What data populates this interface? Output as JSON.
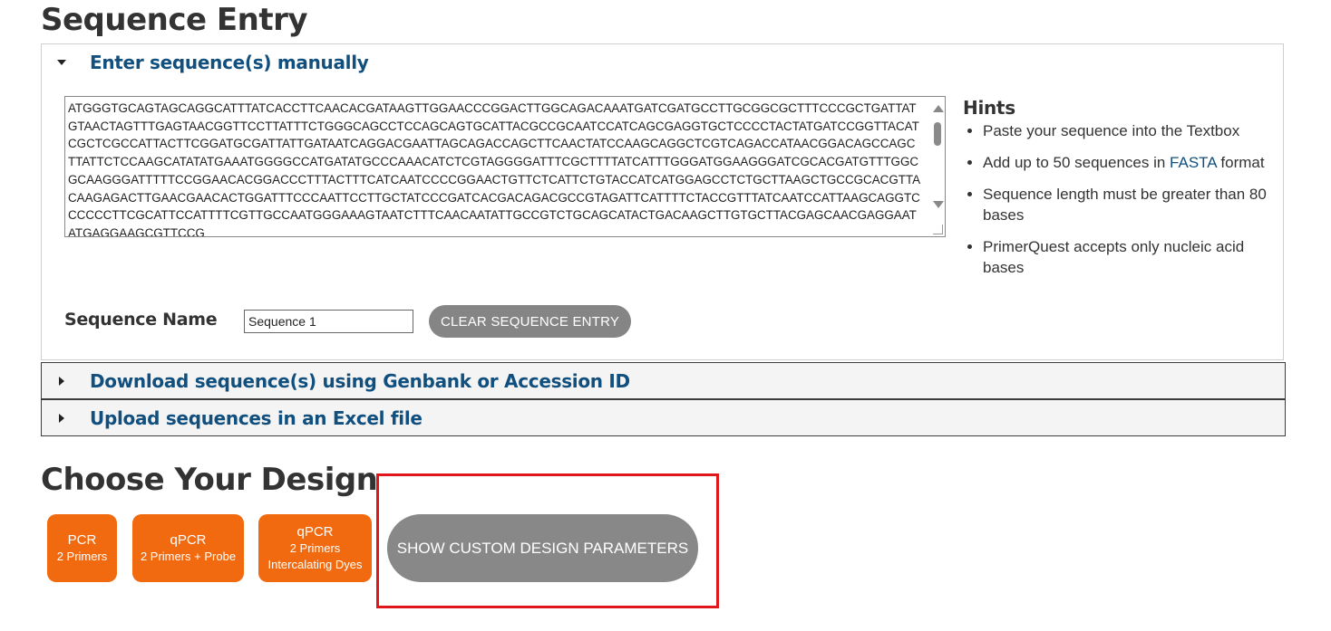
{
  "sequence_entry": {
    "title": "Sequence Entry",
    "sections": {
      "manual": "Enter sequence(s) manually",
      "genbank": "Download sequence(s) using Genbank or Accession ID",
      "excel": "Upload sequences in an Excel file"
    },
    "textarea_value": "ATGGGTGCAGTAGCAGGCATTTATCACCTTCAACACGATAAGTTGGAACCCGGACTTGGCAGACAAATGATCGATGCCTTGCGGCGCTTTCCCGCTGATTATGTAACTAGTTTGAGTAACGGTTCCTTATTTCTGGGCAGCCTCCAGCAGTGCATTACGCCGCAATCCATCAGCGAGGTGCTCCCCTACTATGATCCGGTTACATCGCTCGCCATTACTTCGGATGCGATTATTGATAATCAGGACGAATTAGCAGACCAGCTTCAACTATCCAAGCAGGCTCGTCAGACCATAACGGACAGCCAGCTTATTCTCCAAGCATATATGAAATGGGGCCATGATATGCCCAAACATCTCGTAGGGGATTTCGCTTTTATCATTTGGGATGGAAGGGATCGCACGATGTTTGGCGCAAGGGATTTTTCCGGAACACGGACCCTTTACTTTCATCAATCCCCGGAACTGTTCTCATTCTGTACCATCATGGAGCCTCTGCTTAAGCTGCCGCACGTTACAAGAGACTTGAACGAACACTGGATTTCCCAATTCCTTGCTATCCCGATCACGACAGACGCCGTAGATTCATTTTCTACCGTTTATCAATCCATTAAGCAGGTCCCCCCTTCGCATTCCATTTTCGTTGCCAATGGGAAAGTAATCTTTCAACAATATTGCCGTCTGCAGCATACTGACAAGCTTGTGCTTACGAGCAACGAGGAATATGAGGAAGCGTTCCG",
    "hints": {
      "title": "Hints",
      "items": {
        "h1": "Paste your sequence into the Textbox",
        "h2_pre": "Add up to 50 sequences in ",
        "h2_link": "FASTA",
        "h2_post": " format",
        "h3": "Sequence length must be greater than 80 bases",
        "h4": "PrimerQuest accepts only nucleic acid bases"
      }
    },
    "sequence_name_label": "Sequence Name",
    "sequence_name_value": "Sequence 1",
    "clear_button": "CLEAR SEQUENCE ENTRY"
  },
  "design": {
    "title": "Choose Your Design",
    "buttons": {
      "pcr": {
        "main": "PCR",
        "sub": "2 Primers"
      },
      "qpcr_probe": {
        "main": "qPCR",
        "sub": "2 Primers + Probe"
      },
      "qpcr_dyes": {
        "main": "qPCR",
        "sub1": "2 Primers",
        "sub2": "Intercalating Dyes"
      }
    },
    "custom_button": "SHOW CUSTOM DESIGN PARAMETERS"
  },
  "colors": {
    "link_blue": "#114f7e",
    "orange": "#f26a0f",
    "gray_button": "#888888",
    "highlight_red": "#e0161b"
  }
}
